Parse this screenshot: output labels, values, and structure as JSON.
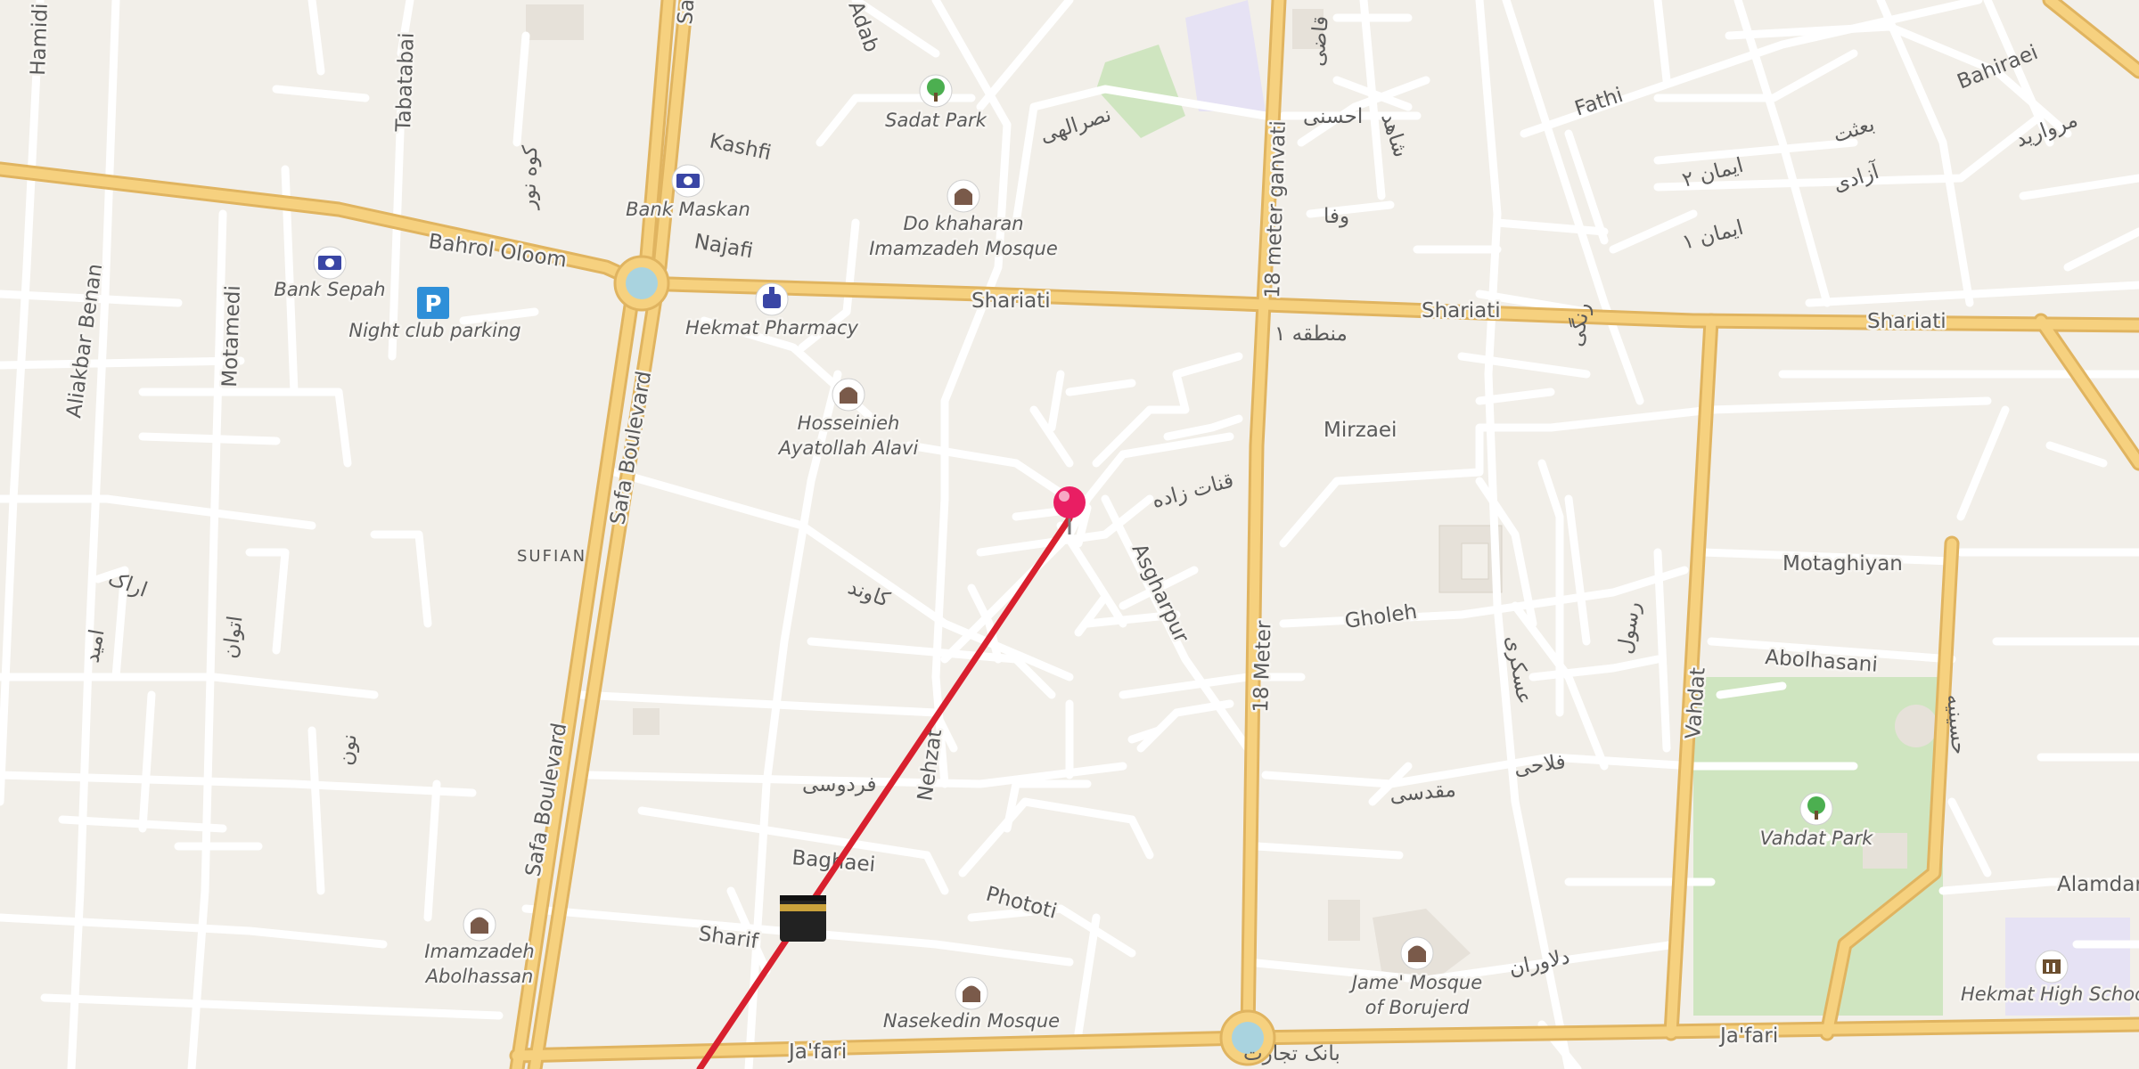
{
  "map": {
    "roads": {
      "major": [
        "Shariati",
        "Safa Boulevard",
        "18 Meter",
        "18 meter ganvati",
        "Vahdat",
        "Ja'fari",
        "Bahrol Oloom"
      ],
      "minor": [
        "Kashfi",
        "Najafi",
        "Fathi",
        "Bahiraei",
        "Mirzaei",
        "Motaghiyan",
        "Abolhasani",
        "Gholeh",
        "Asgharpur",
        "Nehzat",
        "Baghaei",
        "Phototi",
        "Sharif",
        "Alamdar",
        "Aliakbar Benan",
        "Motamedi",
        "Tabatabai",
        "Hamidi",
        "Adab",
        "Sa"
      ],
      "arabic": [
        "نصرالهی",
        "احسنی",
        "وفا",
        "منطقه ۱",
        "قنات زاده",
        "کاوند",
        "فردوسی",
        "مقدسی",
        "دلاوران",
        "فلاحی",
        "بانک تجارت",
        "ایمان ۲",
        "ایمان ۱",
        "بعثت",
        "آزادی",
        "مروارید",
        "عسکری",
        "حسینیه",
        "اتوان",
        "نون",
        "اراک",
        "امید",
        "کوه نور",
        "قاضی",
        "رنگی",
        "رسول",
        "شاهد"
      ]
    },
    "pois": {
      "sadat_park": "Sadat Park",
      "bank_maskan": "Bank Maskan",
      "bank_sepah": "Bank Sepah",
      "night_club_parking": "Night club parking",
      "hekmat_pharmacy": "Hekmat Pharmacy",
      "do_khaharan_1": "Do khaharan",
      "do_khaharan_2": "Imamzadeh Mosque",
      "hosseinieh_1": "Hosseinieh",
      "hosseinieh_2": "Ayatollah Alavi",
      "sufian": "SUFIAN",
      "imamzadeh_1": "Imamzadeh",
      "imamzadeh_2": "Abolhassan",
      "nasekedin": "Nasekedin Mosque",
      "jame_1": "Jame' Mosque",
      "jame_2": "of Borujerd",
      "vahdat_park": "Vahdat Park",
      "hekmat_school": "Hekmat High School"
    },
    "icons": [
      "park-icon",
      "bank-icon",
      "parking-icon",
      "pharmacy-icon",
      "mosque-icon",
      "kaaba-icon",
      "school-icon",
      "location-pin-icon",
      "roundabout-icon"
    ],
    "colors": {
      "background": "#f2efe9",
      "minor_road": "#ffffff",
      "major_road": "#f6d17f",
      "major_road_casing": "#e0b460",
      "park": "#cfe5c0",
      "route_line": "#d8202e",
      "pin": "#e91e63"
    }
  }
}
